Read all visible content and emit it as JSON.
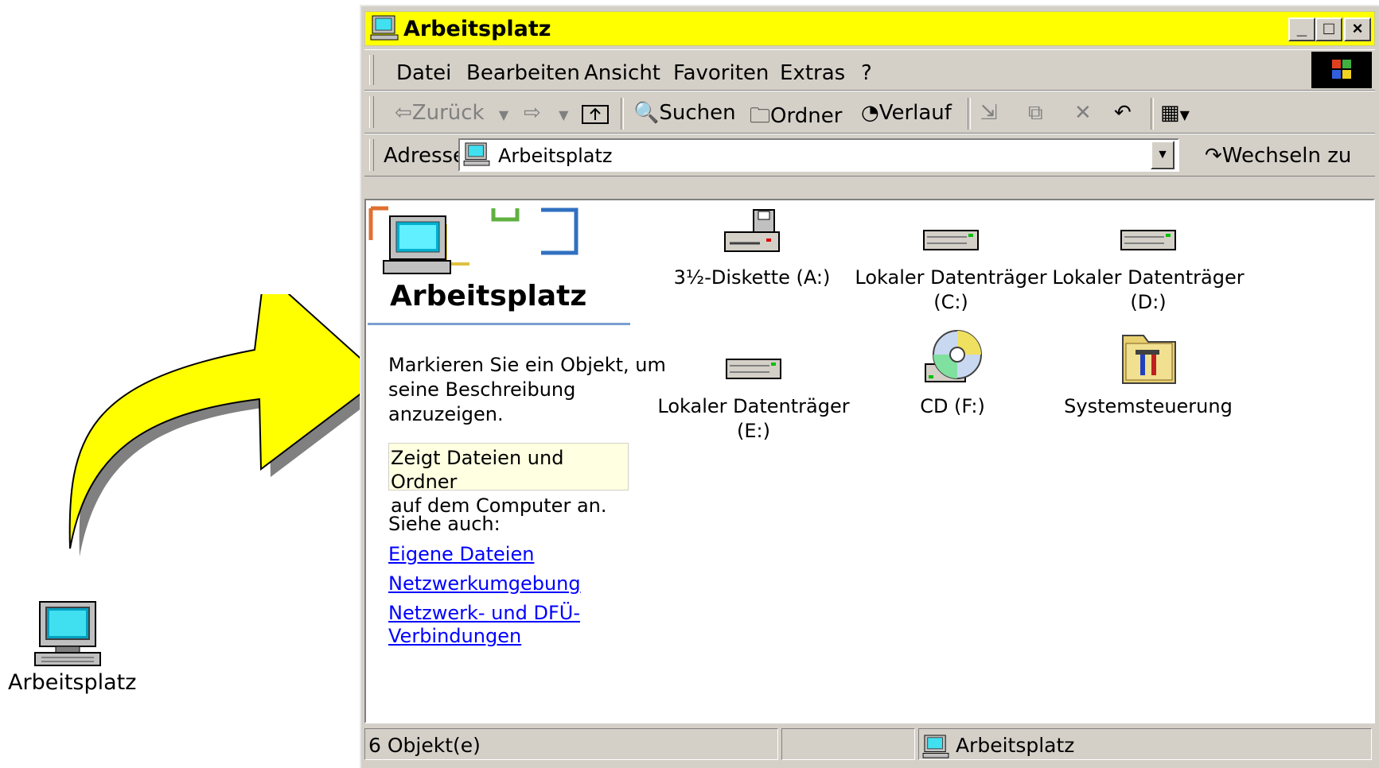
{
  "desktop": {
    "icon_label": "Arbeitsplatz"
  },
  "window": {
    "title": "Arbeitsplatz",
    "controls": {
      "minimize": "_",
      "maximize": "□",
      "close": "×"
    }
  },
  "menu": [
    "Datei",
    "Bearbeiten",
    "Ansicht",
    "Favoriten",
    "Extras",
    "?"
  ],
  "toolbar": {
    "back": "Zurück",
    "search": "Suchen",
    "folders": "Ordner",
    "history": "Verlauf"
  },
  "address": {
    "label": "Adresse",
    "value": "Arbeitsplatz",
    "go": "Wechseln zu"
  },
  "sidebar": {
    "title": "Arbeitsplatz",
    "hint_line1": "Markieren Sie ein Objekt, um",
    "hint_line2": "seine Beschreibung",
    "hint_line3": "anzuzeigen.",
    "tooltip_line1": "Zeigt Dateien und Ordner",
    "tooltip_line2": "auf dem Computer an.",
    "see_also": "Siehe auch:",
    "links": [
      "Eigene Dateien",
      "Netzwerkumgebung",
      "Netzwerk- und DFÜ-",
      "Verbindungen"
    ]
  },
  "items": [
    {
      "line1": "3½-Diskette (A:)",
      "line2": "",
      "icon": "floppy-drive-icon"
    },
    {
      "line1": "Lokaler Datenträger",
      "line2": "(C:)",
      "icon": "hard-disk-icon"
    },
    {
      "line1": "Lokaler Datenträger",
      "line2": "(D:)",
      "icon": "hard-disk-icon"
    },
    {
      "line1": "Lokaler Datenträger",
      "line2": "(E:)",
      "icon": "hard-disk-icon"
    },
    {
      "line1": "CD (F:)",
      "line2": "",
      "icon": "cd-drive-icon"
    },
    {
      "line1": "Systemsteuerung",
      "line2": "",
      "icon": "control-panel-icon"
    }
  ],
  "statusbar": {
    "count": "6 Objekt(e)",
    "location": "Arbeitsplatz"
  },
  "colors": {
    "titlebar": "#ffff00",
    "chrome": "#d4d0c8",
    "link": "#0000ff",
    "arrow": "#ffff00"
  }
}
